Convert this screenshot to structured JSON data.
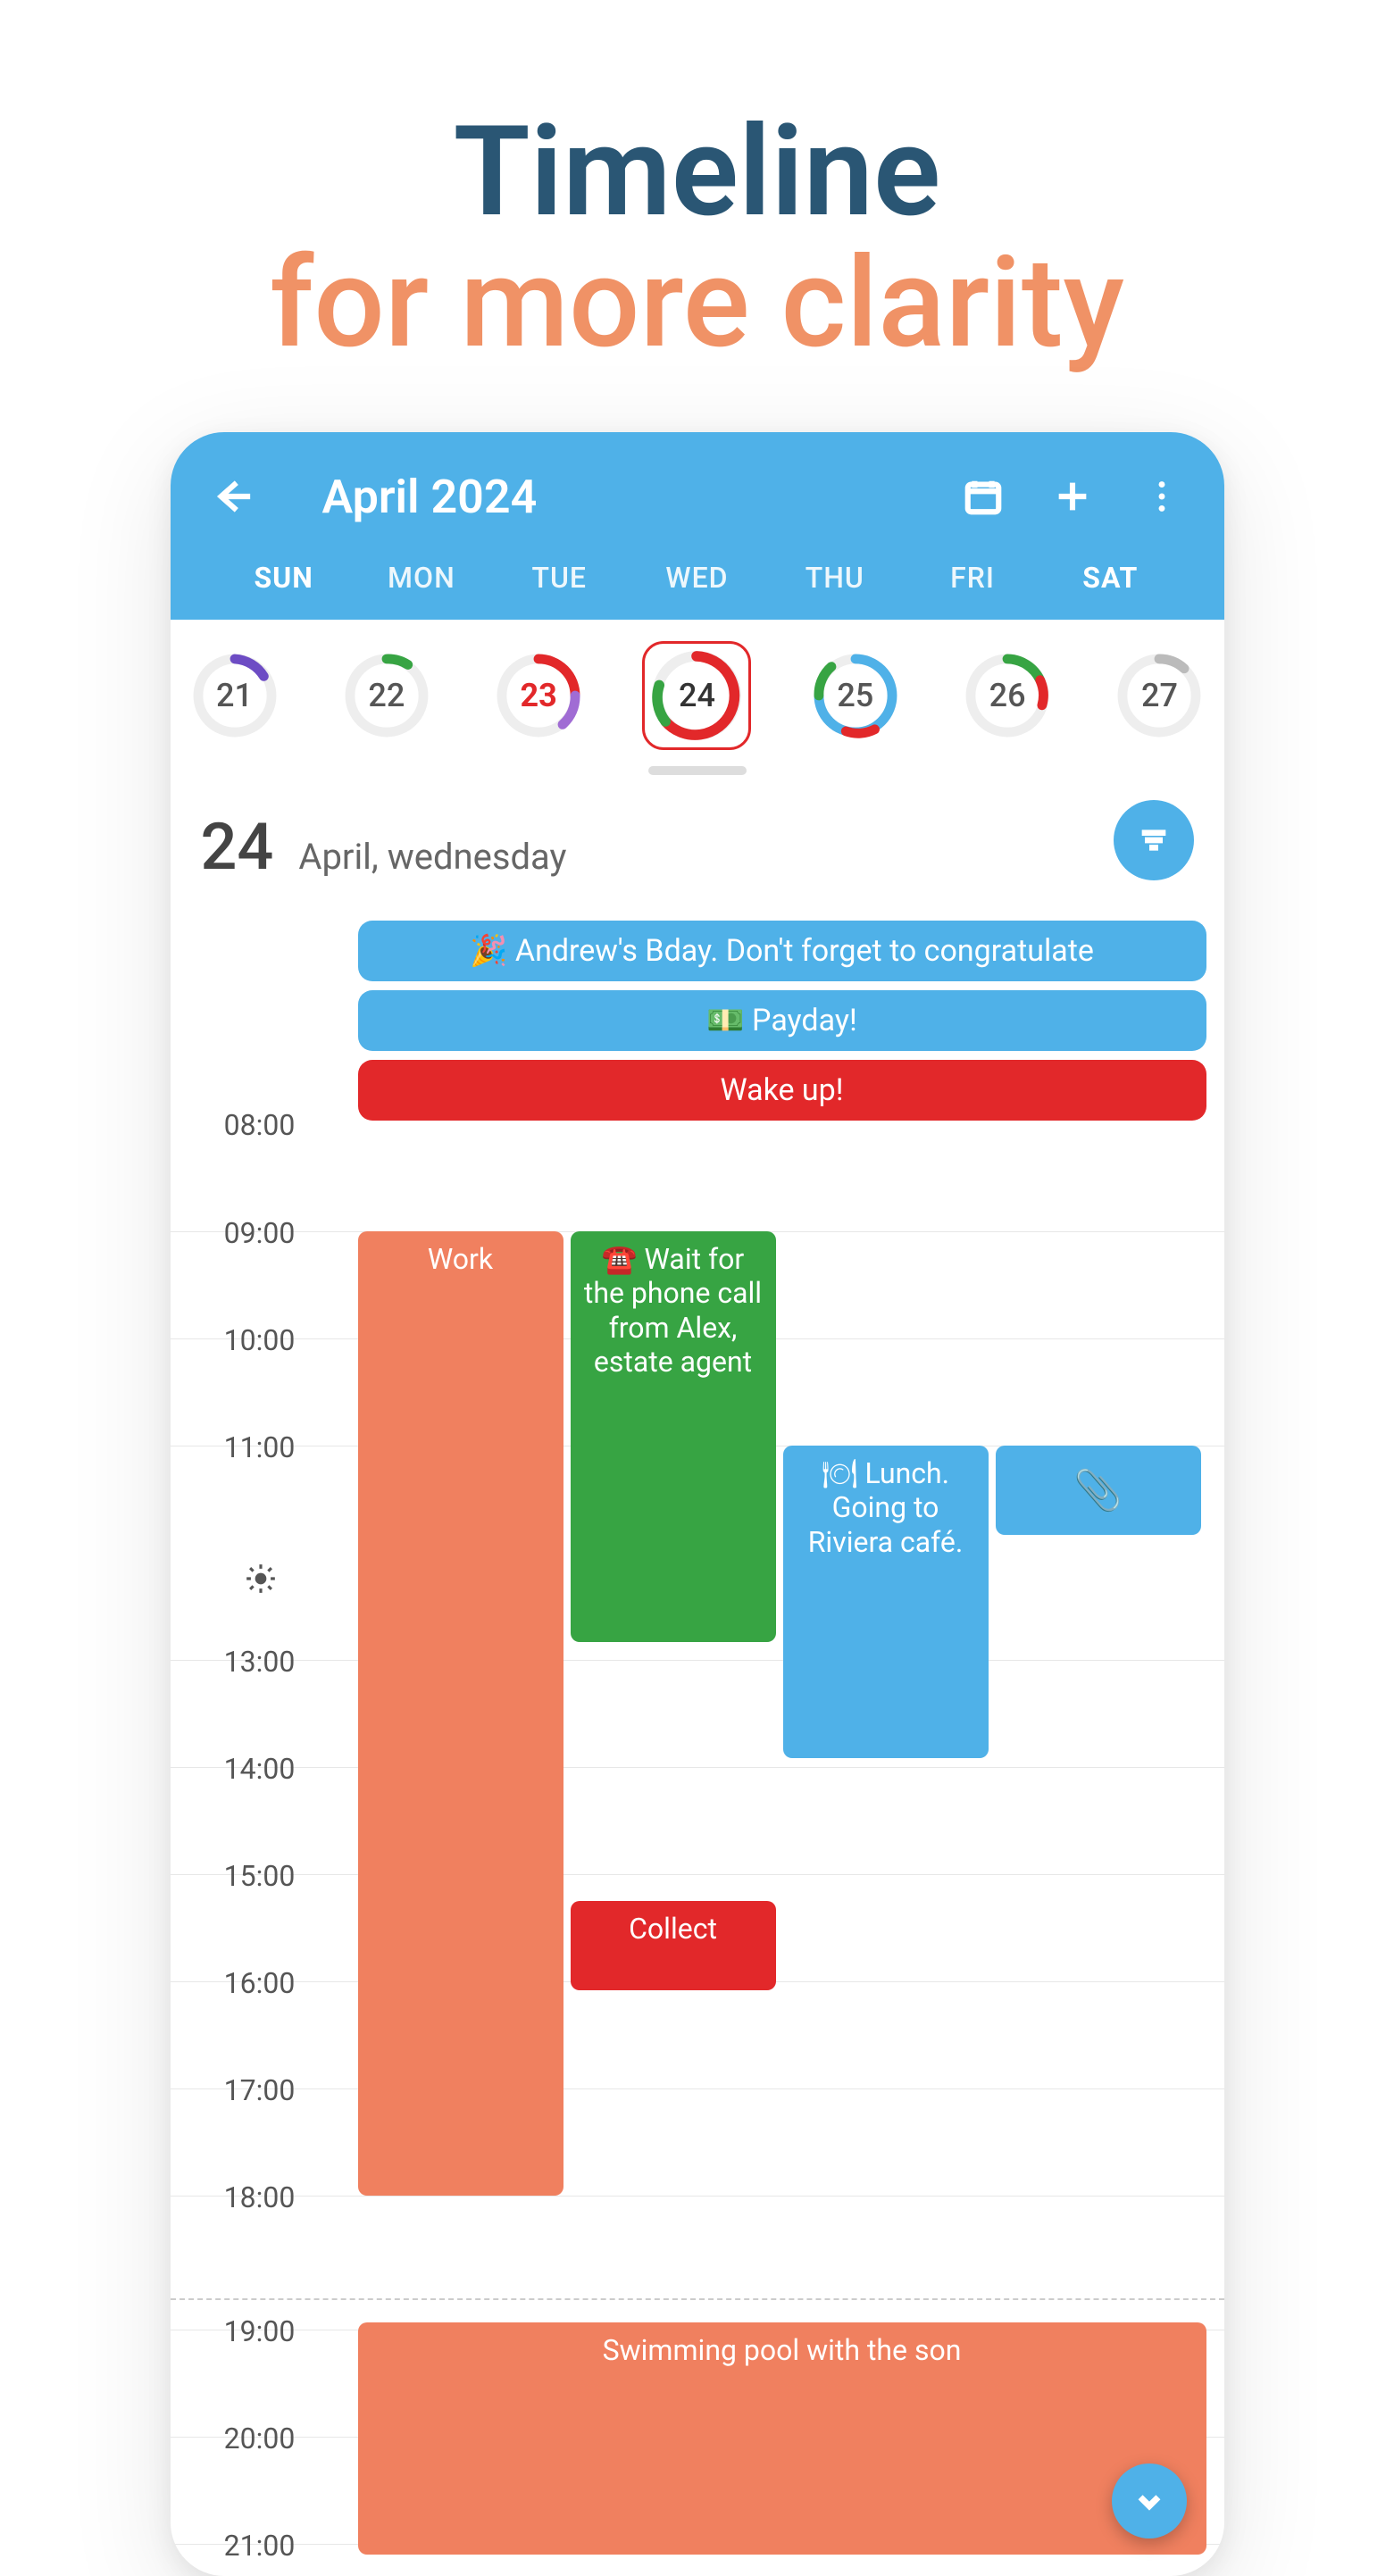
{
  "promo": {
    "line1": "Timeline",
    "line2": "for more clarity"
  },
  "appbar": {
    "title": "April 2024"
  },
  "dow": {
    "labels": [
      "SUN",
      "MON",
      "TUE",
      "WED",
      "THU",
      "FRI",
      "SAT"
    ],
    "current": "SUN",
    "current2": "SAT"
  },
  "dates": {
    "d0": "21",
    "d1": "22",
    "d2": "23",
    "d3": "24",
    "d4": "25",
    "d5": "26",
    "d6": "27"
  },
  "dayheader": {
    "number": "24",
    "rest": "April,  wednesday"
  },
  "allday": {
    "bday": "🎉 Andrew's Bday. Don't forget to congratulate",
    "payday": "💵 Payday!",
    "wake": "Wake up!"
  },
  "hours": {
    "h08": "08:00",
    "h09": "09:00",
    "h10": "10:00",
    "h11": "11:00",
    "h13": "13:00",
    "h14": "14:00",
    "h15": "15:00",
    "h16": "16:00",
    "h17": "17:00",
    "h18": "18:00",
    "h19": "19:00",
    "h20": "20:00",
    "h21": "21:00"
  },
  "events": {
    "work": "Work",
    "phone": "☎️ Wait for the phone call from Alex, estate agent",
    "lunch": "🍽 Lunch. Going to Riviera café.",
    "clip": "📎",
    "collect": "Collect",
    "swim": "Swimming pool with the son"
  }
}
